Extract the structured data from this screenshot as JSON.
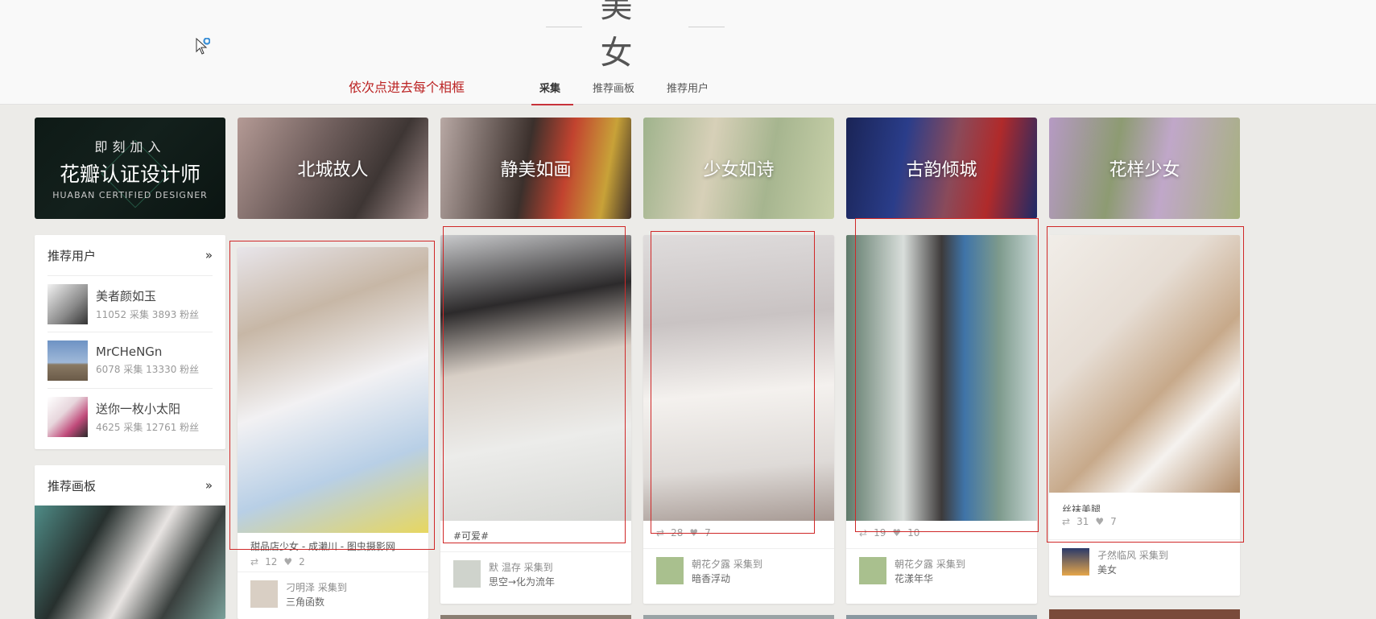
{
  "header": {
    "title": "美女",
    "note": "依次点进去每个相框",
    "tabs": [
      {
        "label": "采集",
        "active": true
      },
      {
        "label": "推荐画板",
        "active": false
      },
      {
        "label": "推荐用户",
        "active": false
      }
    ]
  },
  "banners": [
    {
      "label": "北城故人"
    },
    {
      "label": "静美如画"
    },
    {
      "label": "少女如诗"
    },
    {
      "label": "古韵倾城"
    },
    {
      "label": "花样少女"
    }
  ],
  "designer_banner": {
    "line1": "即刻加入",
    "line2": "花瓣认证设计师",
    "line3": "HUABAN CERTIFIED DESIGNER"
  },
  "recommended_users": {
    "title": "推荐用户",
    "more": "»",
    "users": [
      {
        "name": "美者颜如玉",
        "stats": "11052 采集  3893 粉丝"
      },
      {
        "name": "MrCHeNGn",
        "stats": "6078 采集  13330 粉丝"
      },
      {
        "name": "送你一枚小太阳",
        "stats": "4625 采集  12761 粉丝"
      }
    ]
  },
  "recommended_boards": {
    "title": "推荐画板",
    "more": "»"
  },
  "pins": [
    {
      "desc": "甜品店少女 - 成濑川 - 图虫摄影网",
      "repins": "12",
      "likes": "2",
      "user": "刁明泽 采集到",
      "board": "三角函数"
    },
    {
      "desc": "#可爱#",
      "repins": "",
      "likes": "",
      "user": "默 温存 采集到",
      "board": "思空→化为流年"
    },
    {
      "desc": "",
      "repins": "28",
      "likes": "7",
      "user": "朝花夕露 采集到",
      "board": "暗香浮动"
    },
    {
      "desc": "",
      "repins": "19",
      "likes": "10",
      "user": "朝花夕露 采集到",
      "board": "花漾年华"
    },
    {
      "desc": "丝袜美腿",
      "repins": "31",
      "likes": "7",
      "user": "孑然临风 采集到",
      "board": "美女"
    }
  ],
  "icons": {
    "repin": "repin-icon",
    "like": "heart-icon"
  },
  "colors": {
    "accent": "#c8323a",
    "annotation": "#d02828"
  }
}
